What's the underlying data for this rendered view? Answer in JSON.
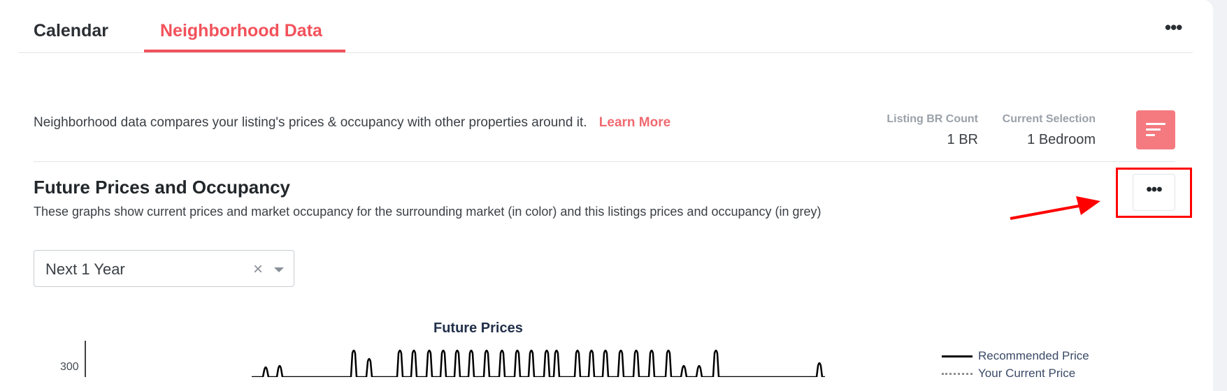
{
  "tabs": [
    {
      "label": "Calendar"
    },
    {
      "label": "Neighborhood Data"
    }
  ],
  "header": {
    "intro_text": "Neighborhood data compares your listing's prices & occupancy with other properties around it.",
    "learn_more": "Learn More",
    "stats": {
      "br_count_label": "Listing BR Count",
      "br_count_value": "1 BR",
      "selection_label": "Current Selection",
      "selection_value": "1 Bedroom"
    }
  },
  "section": {
    "title": "Future Prices and Occupancy",
    "description": "These graphs show current prices and market occupancy for the surrounding market (in color) and this listings prices and occupancy (in grey)"
  },
  "range_select": {
    "value": "Next 1 Year",
    "clear": "×"
  },
  "menu": {
    "more_top": "•••",
    "more_section": "•••"
  },
  "chart_data": {
    "type": "line",
    "title": "Future Prices",
    "y_ticks": [
      "300"
    ],
    "series": [
      {
        "name": "Recommended Price"
      },
      {
        "name": "Your Current Price"
      }
    ]
  },
  "colors": {
    "accent": "#f2525b",
    "filter_button": "#f47a80",
    "annotation": "#ff0000"
  }
}
